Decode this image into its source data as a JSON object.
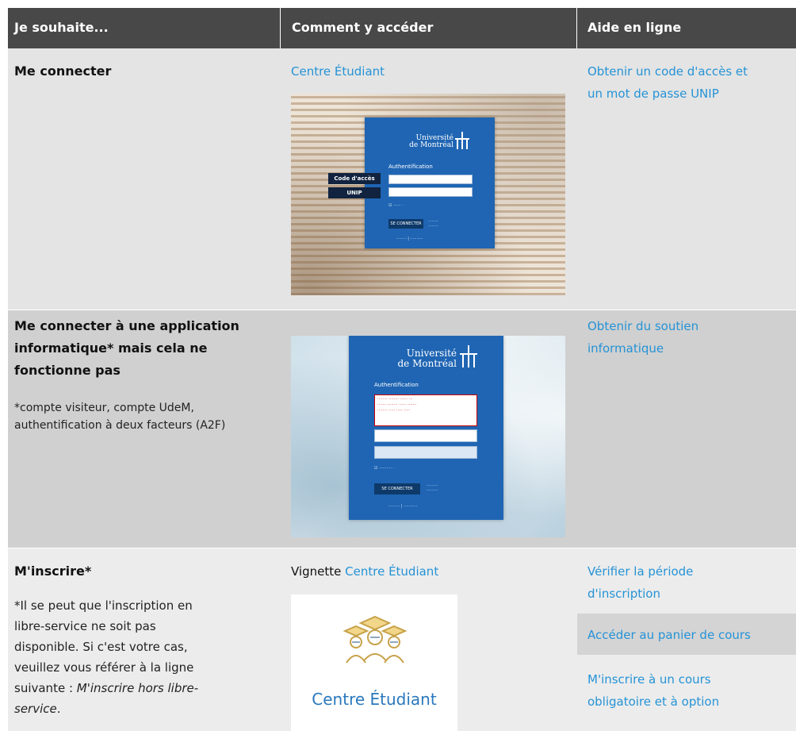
{
  "header": {
    "col1": "Je souhaite...",
    "col2": "Comment y accéder",
    "col3": "Aide en ligne"
  },
  "rows": [
    {
      "title_lines": [
        "Me connecter"
      ],
      "access_link": "Centre Étudiant",
      "help_links": [
        "Obtenir un code d'accès et",
        "un mot de passe UNIP"
      ],
      "screenshot": {
        "brand_line1": "Université",
        "brand_line2": "de Montréal",
        "auth_label": "Authentification",
        "tag1": "Code d'accès",
        "tag2": "UNIP",
        "button": "SE CONNECTER"
      }
    },
    {
      "title_lines": [
        "Me connecter à une application",
        "informatique* mais cela ne",
        "fonctionne pas"
      ],
      "note_lines": [
        "*compte visiteur, compte UdeM,",
        "authentification à deux facteurs (A2F)"
      ],
      "help_links": [
        "Obtenir du soutien",
        "informatique"
      ],
      "screenshot": {
        "brand_line1": "Université",
        "brand_line2": "de Montréal",
        "auth_label": "Authentification",
        "button": "SE CONNECTER"
      }
    },
    {
      "title": "M'inscrire*",
      "note_lines": [
        "*Il se peut que l'inscription en",
        "libre-service ne soit pas",
        "disponible. Si c'est votre cas,",
        "veuillez vous référer à la ligne",
        "suivante : ",
        "M'inscrire hors libre-",
        "service",
        "."
      ],
      "access_prefix": "Vignette",
      "access_link": "Centre Étudiant",
      "tile_label": "Centre Étudiant",
      "tile_icon": "graduates-icon",
      "help_links": [
        [
          "Vérifier la période",
          "d'inscription"
        ],
        [
          "Accéder au panier de cours"
        ],
        [
          "M'inscrire à un cours",
          "obligatoire et à option"
        ]
      ]
    }
  ],
  "colors": {
    "header_bg": "#484848",
    "link": "#2593d6",
    "portal_blue": "#1f65b3"
  }
}
